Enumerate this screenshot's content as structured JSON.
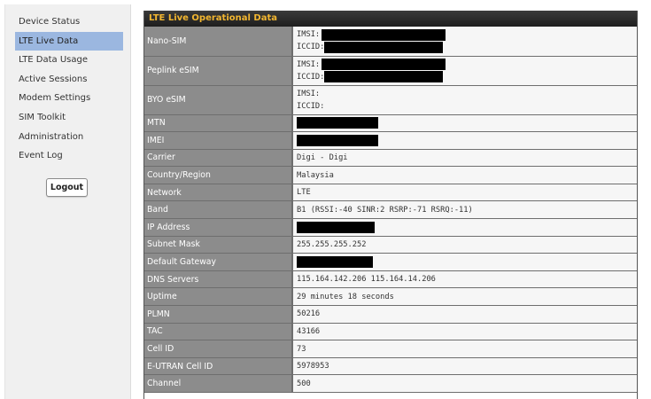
{
  "sidebar": {
    "items": [
      {
        "label": "Device Status",
        "active": false
      },
      {
        "label": "LTE Live Data",
        "active": true
      },
      {
        "label": "LTE Data Usage",
        "active": false
      },
      {
        "label": "Active Sessions",
        "active": false
      },
      {
        "label": "Modem Settings",
        "active": false
      },
      {
        "label": "SIM Toolkit",
        "active": false
      },
      {
        "label": "Administration",
        "active": false
      },
      {
        "label": "Event Log",
        "active": false
      }
    ],
    "logout_label": "Logout"
  },
  "panel": {
    "title": "LTE Live Operational Data",
    "sims": [
      {
        "label": "Nano-SIM",
        "imsi_label": "IMSI:",
        "iccid_label": "ICCID:",
        "imsi_redacted": true,
        "iccid_redacted": true
      },
      {
        "label": "Peplink eSIM",
        "imsi_label": "IMSI:",
        "iccid_label": "ICCID:",
        "imsi_redacted": true,
        "iccid_redacted": true
      },
      {
        "label": "BYO eSIM",
        "imsi_label": "IMSI:",
        "iccid_label": "ICCID:",
        "imsi_redacted": false,
        "iccid_redacted": false
      }
    ],
    "rows": [
      {
        "label": "MTN",
        "value": "",
        "redacted": true
      },
      {
        "label": "IMEI",
        "value": "",
        "redacted": true
      },
      {
        "label": "Carrier",
        "value": "Digi - Digi",
        "redacted": false
      },
      {
        "label": "Country/Region",
        "value": "Malaysia",
        "redacted": false
      },
      {
        "label": "Network",
        "value": "LTE",
        "redacted": false
      },
      {
        "label": "Band",
        "value": "B1 (RSSI:-40 SINR:2 RSRP:-71 RSRQ:-11)",
        "redacted": false
      },
      {
        "label": "IP Address",
        "value": "",
        "redacted": true
      },
      {
        "label": "Subnet Mask",
        "value": "255.255.255.252",
        "redacted": false
      },
      {
        "label": "Default Gateway",
        "value": "",
        "redacted": true
      },
      {
        "label": "DNS Servers",
        "value": "115.164.142.206 115.164.14.206",
        "redacted": false
      },
      {
        "label": "Uptime",
        "value": "29 minutes 18 seconds",
        "redacted": false
      },
      {
        "label": "PLMN",
        "value": "50216",
        "redacted": false
      },
      {
        "label": "TAC",
        "value": "43166",
        "redacted": false
      },
      {
        "label": "Cell ID",
        "value": "73",
        "redacted": false
      },
      {
        "label": "E-UTRAN Cell ID",
        "value": "5978953",
        "redacted": false
      },
      {
        "label": "Channel",
        "value": "500",
        "redacted": false
      }
    ]
  },
  "colors": {
    "header_bg": "#2b2b2b",
    "header_text": "#f2b630",
    "label_bg": "#8c8c8c",
    "value_bg": "#f6f6f6",
    "nav_active_bg": "#9bb7e0"
  }
}
